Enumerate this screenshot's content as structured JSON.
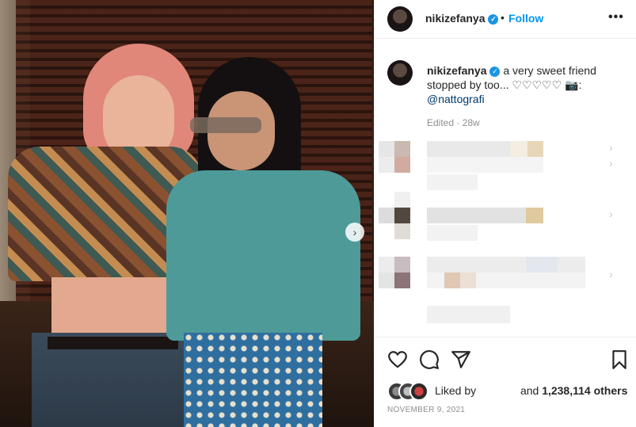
{
  "header": {
    "username": "nikizefanya",
    "separator": "•",
    "follow_label": "Follow",
    "more_icon": "more-dots-icon"
  },
  "caption": {
    "username": "nikizefanya",
    "text": "a very sweet friend stopped by too... ♡♡♡♡♡ 📷:",
    "mention": "@nattografi",
    "edited": "Edited · 28w"
  },
  "likes": {
    "liked_by": "Liked by",
    "and_label": "and",
    "count": "1,238,114 others"
  },
  "date": "NOVEMBER 9, 2021",
  "colors": {
    "accent": "#0095f6",
    "verified": "#1b95e0",
    "muted": "#8e8e8e",
    "text": "#262626"
  }
}
